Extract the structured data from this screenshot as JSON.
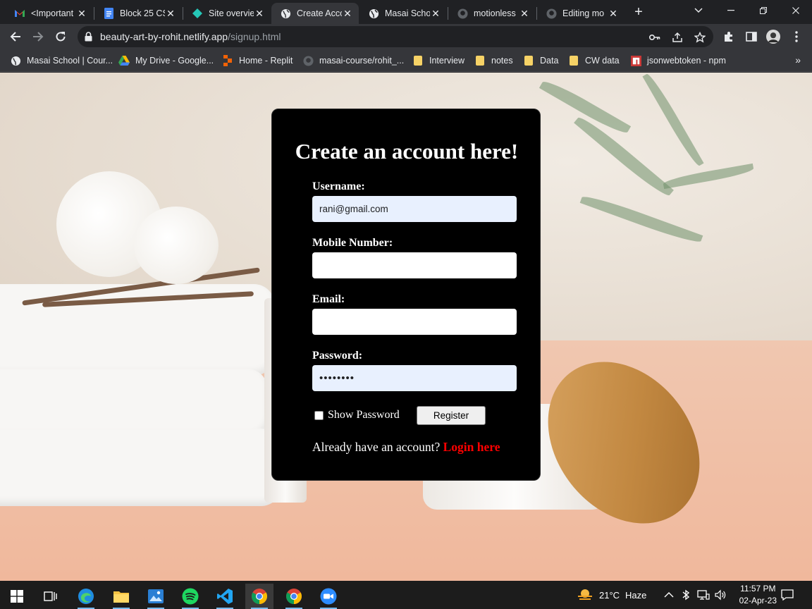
{
  "browser": {
    "tabs": [
      {
        "title": "<Important"
      },
      {
        "title": "Block 25 CS"
      },
      {
        "title": "Site overvie"
      },
      {
        "title": "Create Acco"
      },
      {
        "title": "Masai Scho"
      },
      {
        "title": "motionless"
      },
      {
        "title": "Editing mo"
      }
    ],
    "url_host": "beauty-art-by-rohit.netlify.app",
    "url_path": "/signup.html",
    "bookmarks": [
      {
        "label": "Masai School | Cour..."
      },
      {
        "label": "My Drive - Google..."
      },
      {
        "label": "Home - Replit"
      },
      {
        "label": "masai-course/rohit_..."
      },
      {
        "label": "Interview"
      },
      {
        "label": "notes"
      },
      {
        "label": "Data"
      },
      {
        "label": "CW data"
      },
      {
        "label": "jsonwebtoken - npm"
      }
    ],
    "bookmarks_more": "»"
  },
  "signup": {
    "title": "Create an account here!",
    "username_label": "Username:",
    "username_value": "rani@gmail.com",
    "mobile_label": "Mobile Number:",
    "mobile_value": "",
    "email_label": "Email:",
    "email_value": "",
    "password_label": "Password:",
    "password_value": "••••••••",
    "show_password_label": "Show Password",
    "show_password_checked": false,
    "register_label": "Register",
    "already_text": "Already have an account?",
    "login_link": "Login here"
  },
  "taskbar": {
    "weather_temp": "21°C",
    "weather_desc": "Haze",
    "time": "11:57 PM",
    "date": "02-Apr-23"
  },
  "colors": {
    "card_bg": "#000000",
    "login_link": "#ff0000",
    "autofill_bg": "#e8f0fe"
  }
}
